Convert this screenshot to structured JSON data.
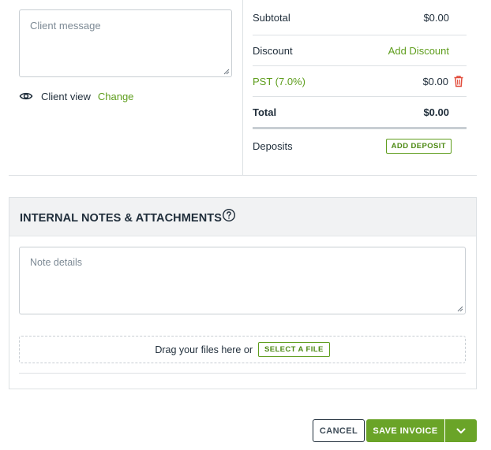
{
  "client_message": {
    "placeholder": "Client message"
  },
  "client_view": {
    "label": "Client view",
    "change_link": "Change",
    "icon": "eye-icon"
  },
  "totals": {
    "subtotal": {
      "label": "Subtotal",
      "value": "$0.00"
    },
    "discount": {
      "label": "Discount",
      "action": "Add Discount"
    },
    "tax": {
      "label": "PST (7.0%)",
      "value": "$0.00",
      "icon": "trash-icon"
    },
    "total": {
      "label": "Total",
      "value": "$0.00"
    },
    "deposits": {
      "label": "Deposits",
      "action": "ADD DEPOSIT"
    }
  },
  "internal_notes": {
    "title": "INTERNAL NOTES & ATTACHMENTS",
    "help_icon": "help-circle-icon",
    "note_placeholder": "Note details",
    "dropzone_text": "Drag your files here or",
    "select_file": "SELECT A FILE"
  },
  "footer": {
    "cancel": "CANCEL",
    "save": "SAVE INVOICE",
    "more_icon": "chevron-down-icon"
  },
  "colors": {
    "accent_green": "#6aa428",
    "link_green": "#5e9d1c",
    "danger_red": "#e24c3b",
    "text_dark": "#1f2d3a"
  }
}
